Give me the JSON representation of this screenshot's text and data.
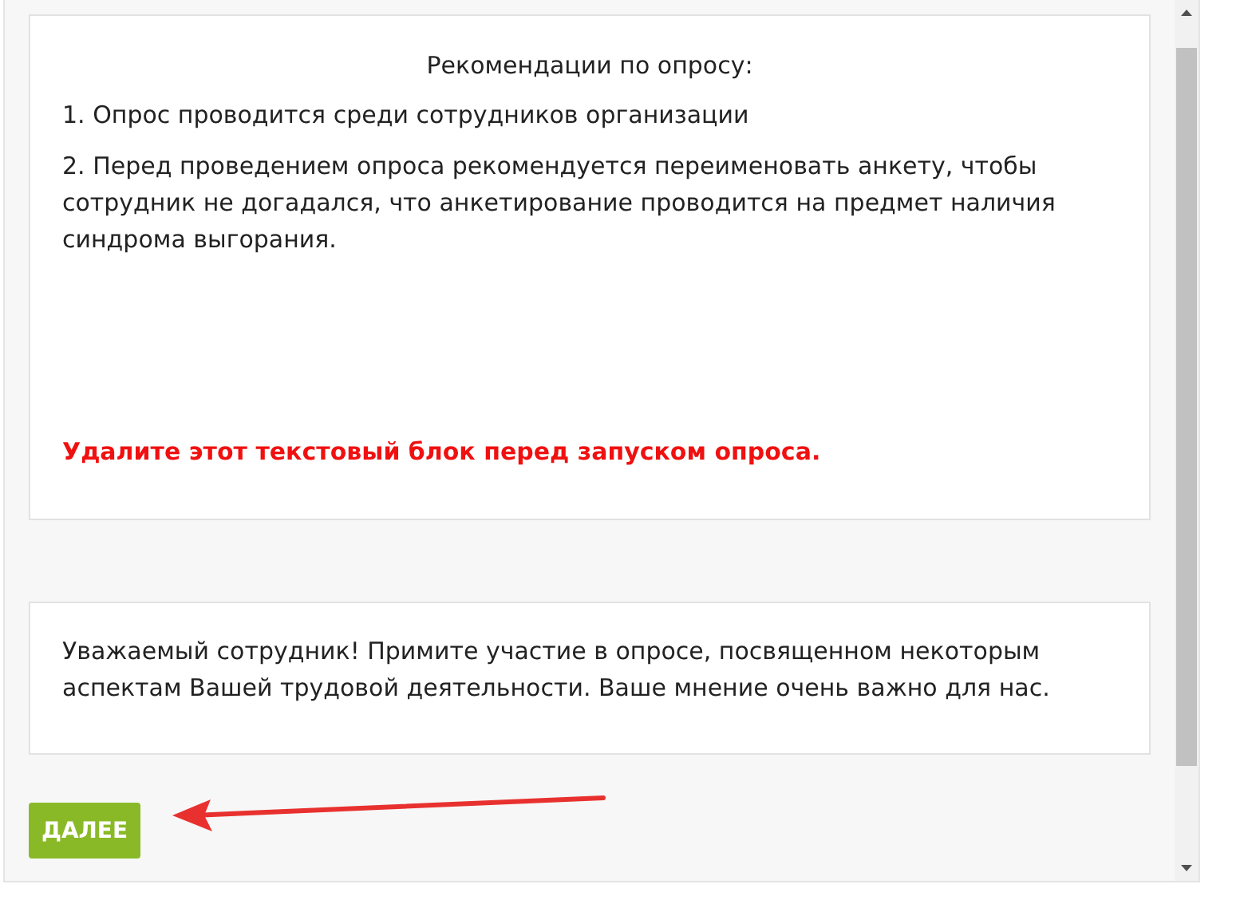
{
  "recommendations": {
    "title": "Рекомендации по опросу:",
    "paragraphs": [
      "1. Опрос проводится среди сотрудников организации",
      "2. Перед проведением опроса рекомендуется переименовать анкету, чтобы сотрудник не догадался, что анкетирование проводится на предмет наличия синдрома выгорания."
    ],
    "warning": "Удалите этот текстовый блок перед запуском опроса."
  },
  "intro": {
    "text": "Уважаемый сотрудник! Примите участие в опросе, посвященном некоторым аспектам Вашей трудовой деятельности. Ваше мнение очень важно для нас."
  },
  "next_button": {
    "label": "ДАЛЕЕ"
  }
}
